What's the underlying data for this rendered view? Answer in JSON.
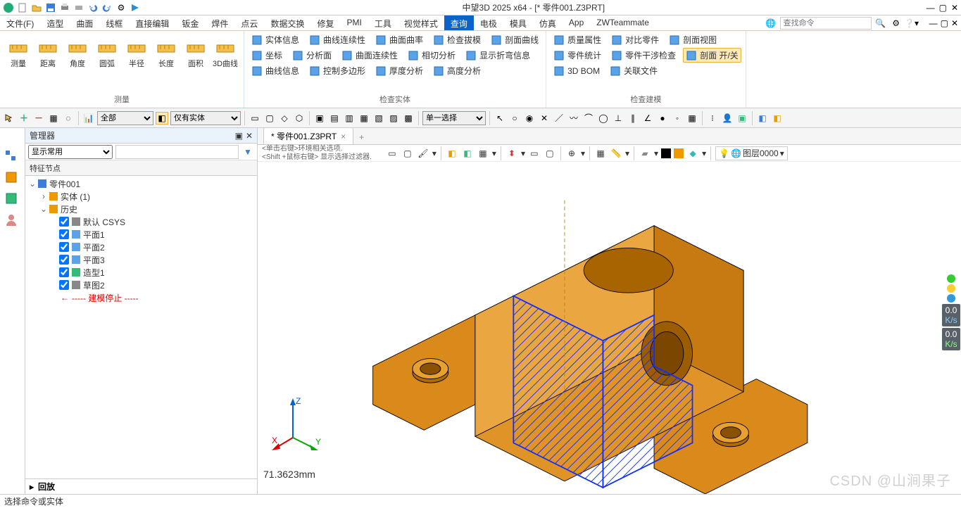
{
  "title": "中望3D 2025 x64 - [* 零件001.Z3PRT]",
  "search_placeholder": "查找命令",
  "menu": {
    "items": [
      "文件(F)",
      "造型",
      "曲面",
      "线框",
      "直接编辑",
      "钣金",
      "焊件",
      "点云",
      "数据交换",
      "修复",
      "PMI",
      "工具",
      "视觉样式",
      "查询",
      "电极",
      "模具",
      "仿真",
      "App",
      "ZWTeammate"
    ],
    "active": "查询"
  },
  "ribbon": {
    "measure": {
      "label": "测量",
      "buttons": [
        "测量",
        "距离",
        "角度",
        "圆弧",
        "半径",
        "长度",
        "面积",
        "3D曲线"
      ]
    },
    "check_entity": {
      "label": "检查实体",
      "rows": [
        [
          "实体信息",
          "曲线连续性",
          "曲面曲率",
          "检查拔模",
          "剖面曲线"
        ],
        [
          "坐标",
          "分析面",
          "曲面连续性",
          "相切分析",
          "显示折弯信息"
        ],
        [
          "曲线信息",
          "控制多边形",
          "厚度分析",
          "高度分析"
        ]
      ]
    },
    "check_model": {
      "label": "检查建模",
      "rows": [
        [
          "质量属性",
          "对比零件",
          "剖面视图"
        ],
        [
          "零件统计",
          "零件干涉检查",
          "剖面 开/关"
        ],
        [
          "3D BOM",
          "关联文件"
        ]
      ],
      "highlight": "剖面 开/关"
    }
  },
  "toolbar2": {
    "filter1": "全部",
    "filter2": "仅有实体",
    "select_mode": "单一选择"
  },
  "manager": {
    "title": "管理器",
    "display_filter": "显示常用",
    "tree_header": "特征节点",
    "playback": "回放",
    "tree": [
      {
        "d": 0,
        "exp": "v",
        "chk": false,
        "icon": "part",
        "label": "零件001"
      },
      {
        "d": 1,
        "exp": ">",
        "chk": true,
        "icon": "body",
        "label": "实体 (1)"
      },
      {
        "d": 1,
        "exp": "v",
        "chk": false,
        "icon": "history",
        "label": "历史"
      },
      {
        "d": 2,
        "exp": "",
        "chk": true,
        "icon": "csys",
        "label": "默认 CSYS"
      },
      {
        "d": 2,
        "exp": "",
        "chk": true,
        "icon": "plane",
        "label": "平面1"
      },
      {
        "d": 2,
        "exp": "",
        "chk": true,
        "icon": "plane",
        "label": "平面2"
      },
      {
        "d": 2,
        "exp": "",
        "chk": true,
        "icon": "plane",
        "label": "平面3"
      },
      {
        "d": 2,
        "exp": "",
        "chk": true,
        "icon": "feature",
        "label": "造型1"
      },
      {
        "d": 2,
        "exp": "",
        "chk": true,
        "icon": "sketch",
        "label": "草图2"
      },
      {
        "d": 2,
        "exp": "",
        "chk": false,
        "icon": "stop",
        "label": "----- 建模停止 -----",
        "stop": true
      }
    ]
  },
  "viewport": {
    "tab": "* 零件001.Z3PRT",
    "hint1": "<单击右键>环境相关选项.",
    "hint2": "<Shift +鼠标右键> 显示选择过滤器.",
    "layer": "图层0000",
    "measurement": "71.3623mm",
    "axes": {
      "x": "X",
      "y": "Y",
      "z": "Z"
    },
    "gauge": [
      {
        "v": "0.0",
        "u": "K/s"
      },
      {
        "v": "0.0",
        "u": "K/s"
      }
    ]
  },
  "statusbar": "选择命令或实体",
  "watermark": "CSDN @山涧果子"
}
